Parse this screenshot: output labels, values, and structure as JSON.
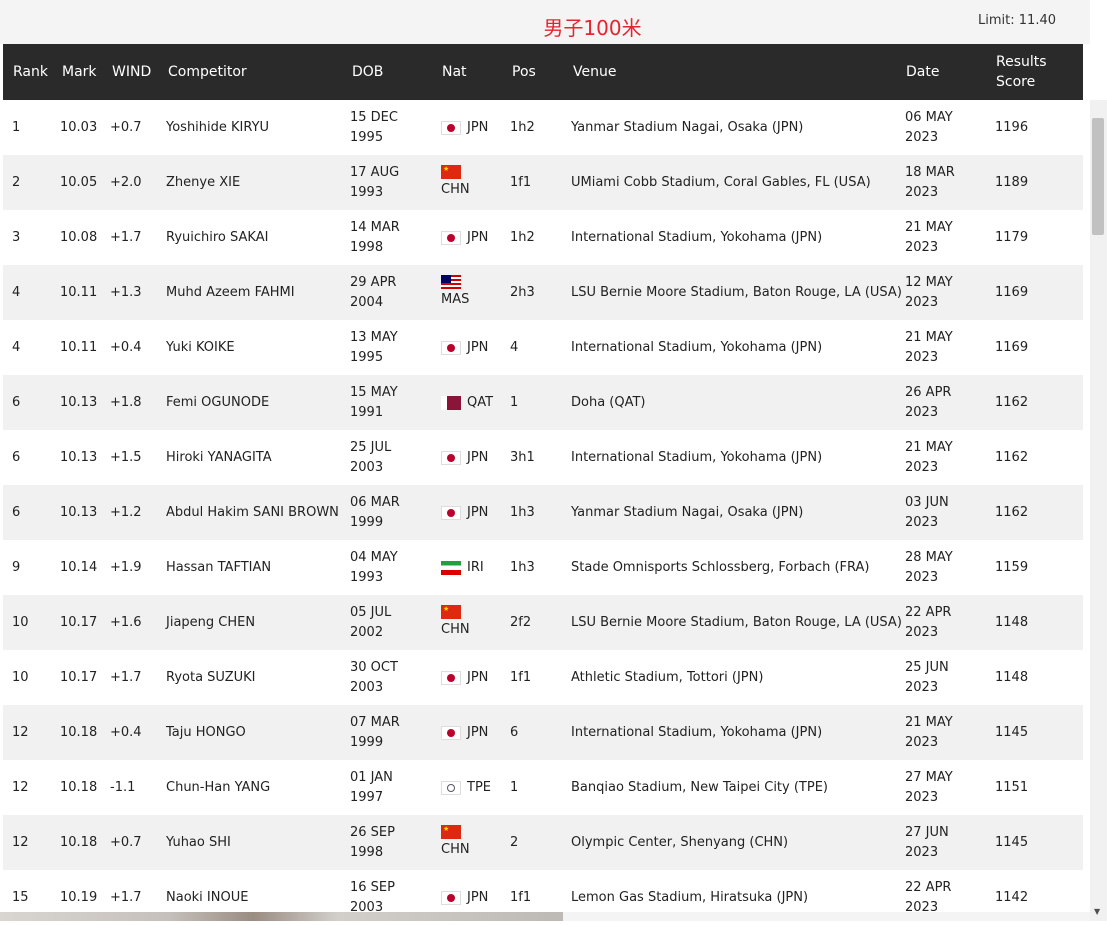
{
  "title": "男子100米",
  "limit": "Limit: 11.40",
  "headers": {
    "rank": "Rank",
    "mark": "Mark",
    "wind": "WIND",
    "competitor": "Competitor",
    "dob": "DOB",
    "nat": "Nat",
    "pos": "Pos",
    "venue": "Venue",
    "date": "Date",
    "score_line1": "Results",
    "score_line2": "Score"
  },
  "rows": [
    {
      "rank": "1",
      "mark": "10.03",
      "wind": "+0.7",
      "competitor": "Yoshihide KIRYU",
      "dob1": "15 DEC",
      "dob2": "1995",
      "flag": "jpn",
      "nat": "JPN",
      "pos": "1h2",
      "venue": "Yanmar Stadium Nagai, Osaka (JPN)",
      "date1": "06 MAY",
      "date2": "2023",
      "score": "1196"
    },
    {
      "rank": "2",
      "mark": "10.05",
      "wind": "+2.0",
      "competitor": "Zhenye XIE",
      "dob1": "17 AUG",
      "dob2": "1993",
      "flag": "chn",
      "nat": "CHN",
      "pos": "1f1",
      "venue": "UMiami Cobb Stadium, Coral Gables, FL (USA)",
      "date1": "18 MAR",
      "date2": "2023",
      "score": "1189"
    },
    {
      "rank": "3",
      "mark": "10.08",
      "wind": "+1.7",
      "competitor": "Ryuichiro SAKAI",
      "dob1": "14 MAR",
      "dob2": "1998",
      "flag": "jpn",
      "nat": "JPN",
      "pos": "1h2",
      "venue": "International Stadium, Yokohama (JPN)",
      "date1": "21 MAY",
      "date2": "2023",
      "score": "1179"
    },
    {
      "rank": "4",
      "mark": "10.11",
      "wind": "+1.3",
      "competitor": "Muhd Azeem FAHMI",
      "dob1": "29 APR",
      "dob2": "2004",
      "flag": "mas",
      "nat": "MAS",
      "pos": "2h3",
      "venue": "LSU Bernie Moore Stadium, Baton Rouge, LA (USA)",
      "date1": "12 MAY",
      "date2": "2023",
      "score": "1169"
    },
    {
      "rank": "4",
      "mark": "10.11",
      "wind": "+0.4",
      "competitor": "Yuki KOIKE",
      "dob1": "13 MAY",
      "dob2": "1995",
      "flag": "jpn",
      "nat": "JPN",
      "pos": "4",
      "venue": "International Stadium, Yokohama (JPN)",
      "date1": "21 MAY",
      "date2": "2023",
      "score": "1169"
    },
    {
      "rank": "6",
      "mark": "10.13",
      "wind": "+1.8",
      "competitor": "Femi OGUNODE",
      "dob1": "15 MAY",
      "dob2": "1991",
      "flag": "qat",
      "nat": "QAT",
      "pos": "1",
      "venue": "Doha (QAT)",
      "date1": "26 APR",
      "date2": "2023",
      "score": "1162"
    },
    {
      "rank": "6",
      "mark": "10.13",
      "wind": "+1.5",
      "competitor": "Hiroki YANAGITA",
      "dob1": "25 JUL",
      "dob2": "2003",
      "flag": "jpn",
      "nat": "JPN",
      "pos": "3h1",
      "venue": "International Stadium, Yokohama (JPN)",
      "date1": "21 MAY",
      "date2": "2023",
      "score": "1162"
    },
    {
      "rank": "6",
      "mark": "10.13",
      "wind": "+1.2",
      "competitor": "Abdul Hakim SANI BROWN",
      "dob1": "06 MAR",
      "dob2": "1999",
      "flag": "jpn",
      "nat": "JPN",
      "pos": "1h3",
      "venue": "Yanmar Stadium Nagai, Osaka (JPN)",
      "date1": "03 JUN",
      "date2": "2023",
      "score": "1162"
    },
    {
      "rank": "9",
      "mark": "10.14",
      "wind": "+1.9",
      "competitor": "Hassan TAFTIAN",
      "dob1": "04 MAY",
      "dob2": "1993",
      "flag": "iri",
      "nat": "IRI",
      "pos": "1h3",
      "venue": "Stade Omnisports Schlossberg, Forbach (FRA)",
      "date1": "28 MAY",
      "date2": "2023",
      "score": "1159"
    },
    {
      "rank": "10",
      "mark": "10.17",
      "wind": "+1.6",
      "competitor": "Jiapeng CHEN",
      "dob1": "05 JUL",
      "dob2": "2002",
      "flag": "chn",
      "nat": "CHN",
      "pos": "2f2",
      "venue": "LSU Bernie Moore Stadium, Baton Rouge, LA (USA)",
      "date1": "22 APR",
      "date2": "2023",
      "score": "1148"
    },
    {
      "rank": "10",
      "mark": "10.17",
      "wind": "+1.7",
      "competitor": "Ryota SUZUKI",
      "dob1": "30 OCT",
      "dob2": "2003",
      "flag": "jpn",
      "nat": "JPN",
      "pos": "1f1",
      "venue": "Athletic Stadium, Tottori (JPN)",
      "date1": "25 JUN",
      "date2": "2023",
      "score": "1148"
    },
    {
      "rank": "12",
      "mark": "10.18",
      "wind": "+0.4",
      "competitor": "Taju HONGO",
      "dob1": "07 MAR",
      "dob2": "1999",
      "flag": "jpn",
      "nat": "JPN",
      "pos": "6",
      "venue": "International Stadium, Yokohama (JPN)",
      "date1": "21 MAY",
      "date2": "2023",
      "score": "1145"
    },
    {
      "rank": "12",
      "mark": "10.18",
      "wind": "-1.1",
      "competitor": "Chun-Han YANG",
      "dob1": "01 JAN",
      "dob2": "1997",
      "flag": "tpe",
      "nat": "TPE",
      "pos": "1",
      "venue": "Banqiao Stadium, New Taipei City (TPE)",
      "date1": "27 MAY",
      "date2": "2023",
      "score": "1151"
    },
    {
      "rank": "12",
      "mark": "10.18",
      "wind": "+0.7",
      "competitor": "Yuhao SHI",
      "dob1": "26 SEP",
      "dob2": "1998",
      "flag": "chn",
      "nat": "CHN",
      "pos": "2",
      "venue": "Olympic Center, Shenyang (CHN)",
      "date1": "27 JUN",
      "date2": "2023",
      "score": "1145"
    },
    {
      "rank": "15",
      "mark": "10.19",
      "wind": "+1.7",
      "competitor": "Naoki INOUE",
      "dob1": "16 SEP",
      "dob2": "2003",
      "flag": "jpn",
      "nat": "JPN",
      "pos": "1f1",
      "venue": "Lemon Gas Stadium, Hiratsuka (JPN)",
      "date1": "22 APR",
      "date2": "2023",
      "score": "1142"
    }
  ]
}
